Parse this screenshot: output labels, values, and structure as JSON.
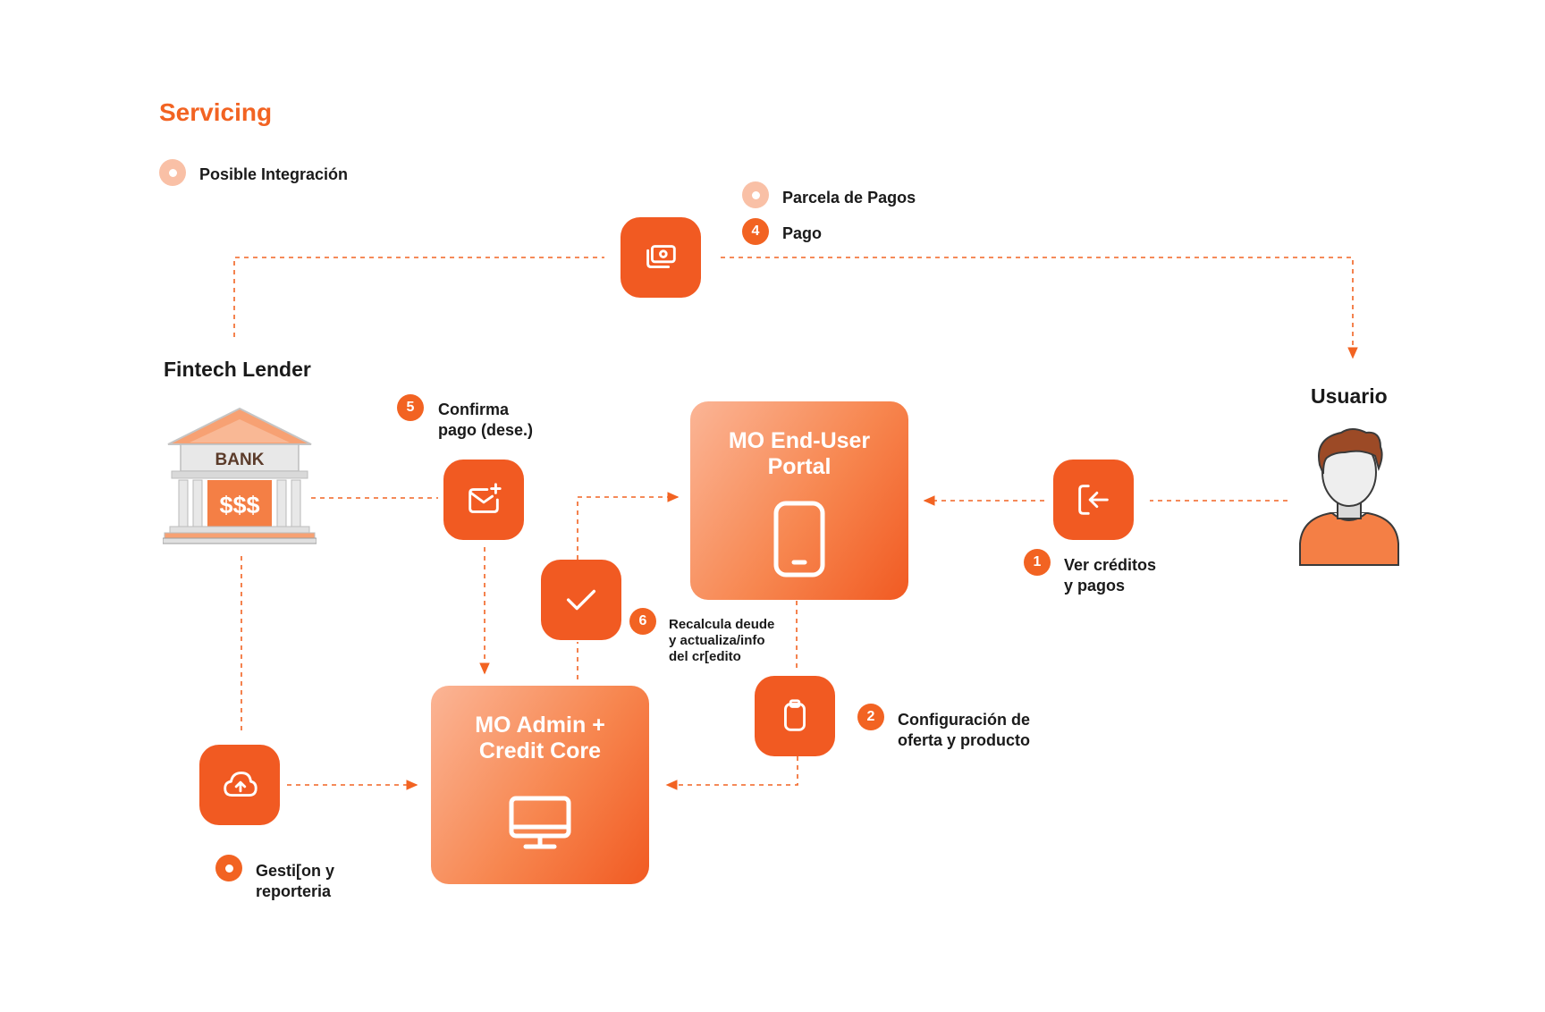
{
  "title": "Servicing",
  "legend": {
    "possible_integration": "Posible Integración",
    "installment": "Parcela de Pagos"
  },
  "actors": {
    "lender": "Fintech Lender",
    "user": "Usuario",
    "bank_sign": "BANK",
    "bank_money": "$$$"
  },
  "systems": {
    "portal": "MO End-User\nPortal",
    "admin": "MO Admin +\nCredit Core"
  },
  "steps": {
    "s1": {
      "number": "1",
      "line1": "Ver créditos",
      "line2": "y pagos"
    },
    "s2": {
      "number": "2",
      "line1": "Configuración de",
      "line2": "oferta y producto"
    },
    "s4": {
      "number": "4",
      "label": "Pago"
    },
    "s5": {
      "number": "5",
      "line1": "Confirma",
      "line2": "pago (dese.)"
    },
    "s6": {
      "number": "6",
      "line1": "Recalcula deude",
      "line2": "y actualiza/info",
      "line3": "del cr[edito"
    },
    "management": {
      "line1": "Gesti[on y",
      "line2": "reporteria"
    }
  },
  "icons": {
    "payment": "money-icon",
    "confirm": "mail-plus-icon",
    "check": "check-icon",
    "login": "login-icon",
    "config": "clipboard-icon",
    "upload": "cloud-upload-icon",
    "portal": "smartphone-icon",
    "admin": "monitor-icon"
  },
  "colors": {
    "accent": "#f26322",
    "accent_light": "#f9c0a6",
    "icon_box": "#f15a22"
  }
}
